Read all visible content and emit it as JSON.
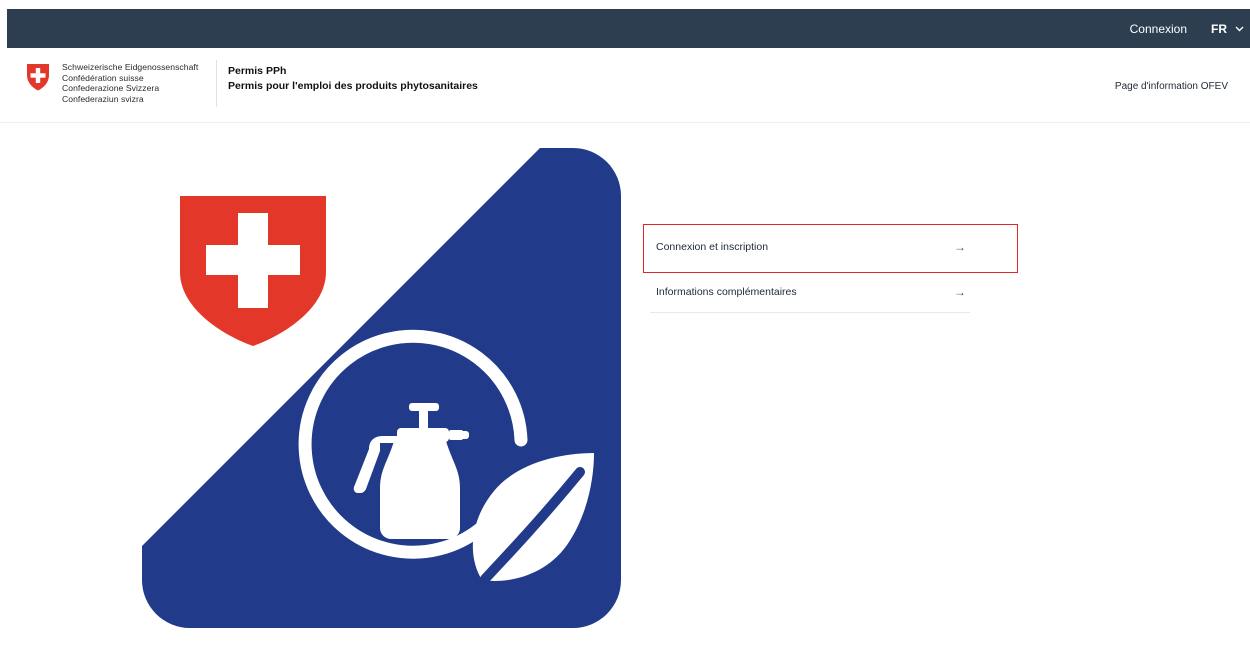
{
  "topbar": {
    "login_label": "Connexion",
    "language_label": "FR",
    "background": "#2c3e50"
  },
  "header": {
    "confederation_lines": [
      "Schweizerische Eidgenossenschaft",
      "Confédération suisse",
      "Confederazione Svizzera",
      "Confederaziun svizra"
    ],
    "app_title": "Permis PPh",
    "app_subtitle": "Permis pour l'emploi des produits phytosanitaires",
    "info_link": "Page d'information OFEV"
  },
  "logo": {
    "primary_color": "#213a8a",
    "coat_red": "#e3372a",
    "icons": [
      "swiss-coat-of-arms-icon",
      "sprayer-icon",
      "leaf-icon"
    ]
  },
  "menu": {
    "items": [
      {
        "label": "Connexion et inscription",
        "arrow": "→",
        "highlighted": true
      },
      {
        "label": "Informations complémentaires",
        "arrow": "→",
        "highlighted": false
      }
    ],
    "highlight_color": "#e0262b"
  }
}
